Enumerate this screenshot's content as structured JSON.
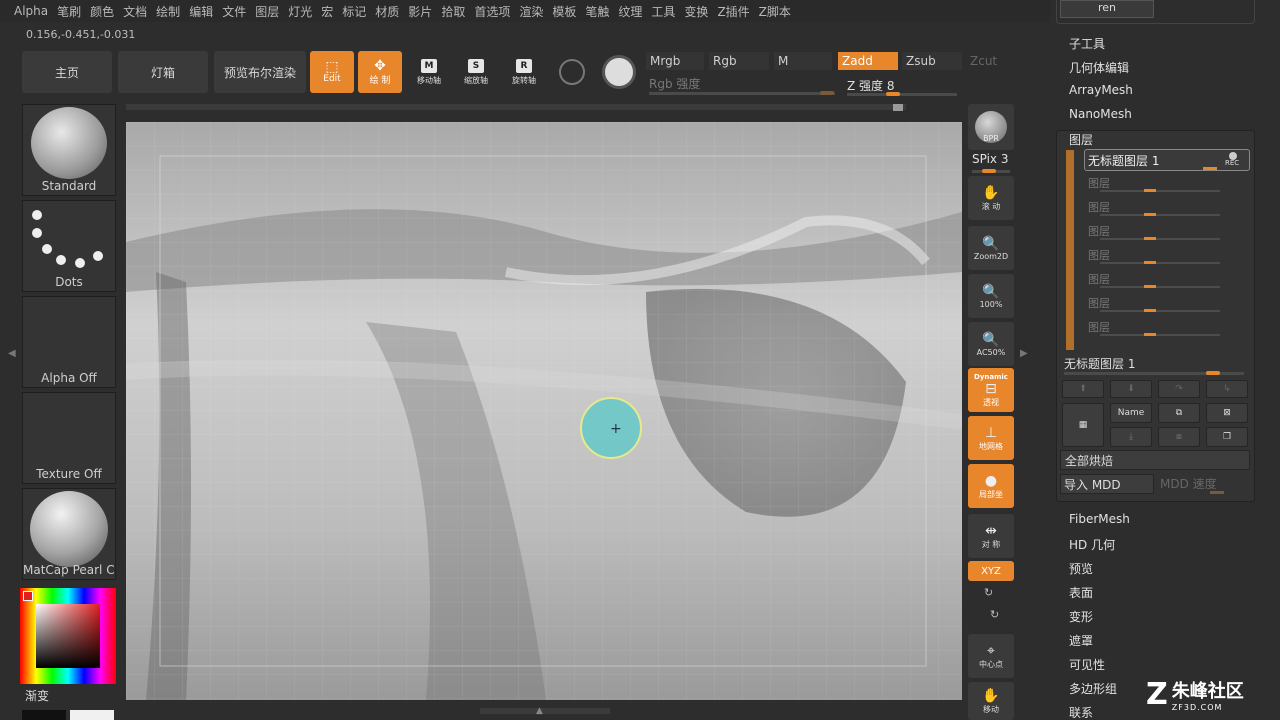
{
  "menubar": {
    "items": [
      "Alpha",
      "笔刷",
      "颜色",
      "文档",
      "绘制",
      "编辑",
      "文件",
      "图层",
      "灯光",
      "宏",
      "标记",
      "材质",
      "影片",
      "拾取",
      "首选项",
      "渲染",
      "模板",
      "笔触",
      "纹理",
      "工具",
      "变换",
      "Z插件",
      "Z脚本"
    ]
  },
  "coords": "0.156,-0.451,-0.031",
  "toolbar": {
    "home": "主页",
    "lightbox": "灯箱",
    "preview": "预览布尔渲染",
    "edit": "Edit",
    "draw": "绘 制",
    "move": "移动轴",
    "scale": "缩放轴",
    "rotate": "旋转轴",
    "mrgb": "Mrgb",
    "rgb": "Rgb",
    "m": "M",
    "zadd": "Zadd",
    "zsub": "Zsub",
    "zcut": "Zcut",
    "rgb_intensity": "Rgb 强度",
    "z_intensity": "Z 强度 8"
  },
  "left_shelf": {
    "brush": "Standard",
    "stroke": "Dots",
    "alpha": "Alpha Off",
    "texture": "Texture Off",
    "material": "MatCap Pearl Ca",
    "gradient": "渐变"
  },
  "right_shelf": {
    "bpr": "BPR",
    "spix": "SPix 3",
    "scroll": "滚 动",
    "zoom2d": "Zoom2D",
    "actual": "100%",
    "ac50": "AC50%",
    "dynamic": "Dynamic",
    "persp": "透视",
    "floor": "地网格",
    "local": "局部坐",
    "sym": "对 称",
    "xyz": "XYZ",
    "center": "中心点",
    "move": "移动"
  },
  "right_panel": {
    "top_button": "ren",
    "menu": [
      "子工具",
      "几何体编辑",
      "ArrayMesh",
      "NanoMesh"
    ],
    "layers_title": "图层",
    "active_layer": "无标题图层 1",
    "rec": "REC",
    "empty_layers": [
      "图层",
      "图层",
      "图层",
      "图层",
      "图层",
      "图层",
      "图层"
    ],
    "layer_name": "无标题图层 1",
    "name_btn": "Name",
    "bake_all": "全部烘焙",
    "import_mdd": "导入 MDD",
    "mdd_speed": "MDD 速度",
    "menu2": [
      "FiberMesh",
      "HD 几何",
      "预览",
      "表面",
      "变形",
      "遮罩",
      "可见性",
      "多边形组",
      "联系"
    ]
  },
  "watermark": {
    "text": "朱峰社区",
    "url": "ZF3D.COM"
  },
  "colors": {
    "accent": "#e8862b",
    "canvas_bg": "#8a8a8a",
    "brush_cursor": "#6fc7c7"
  }
}
